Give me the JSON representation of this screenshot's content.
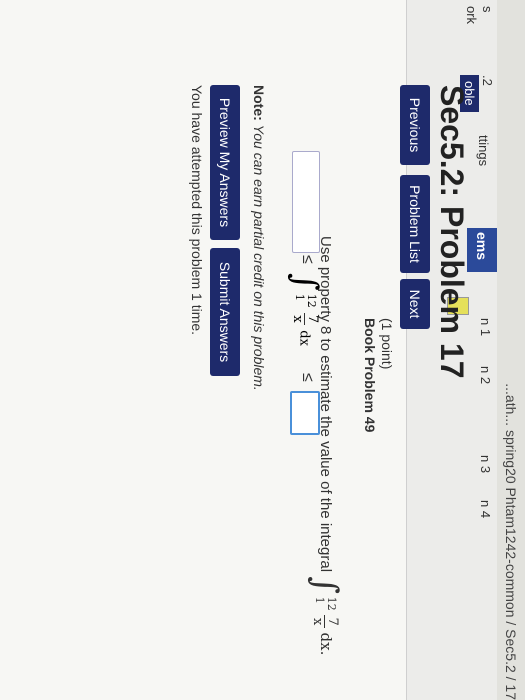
{
  "header": {
    "breadcrumb": "...ath... spring20 Phtam1242-common / Sec5.2 / 17"
  },
  "sidebar": {
    "items": [
      {
        "label": "s"
      },
      {
        "label": "ork"
      },
      {
        "label": ".2"
      },
      {
        "label": "oble"
      },
      {
        "label": "ttings"
      },
      {
        "label": "ems"
      },
      {
        "label": "n 1"
      },
      {
        "label": "n 2"
      },
      {
        "label": "n 3"
      },
      {
        "label": "n 4"
      }
    ]
  },
  "page": {
    "title": "Sec5.2: Problem 17"
  },
  "nav": {
    "previous": "Previous",
    "problem_list": "Problem List",
    "next": "Next"
  },
  "problem": {
    "points": "(1 point)",
    "book_problem": "Book Problem 49",
    "instruction": "Use property 8 to estimate the value of the integral",
    "integral_upper": "12",
    "integral_lower": "1",
    "integrand_num": "7",
    "integrand_den": "x",
    "dx": "dx.",
    "answer_dx": "dx",
    "le_symbol": "≤"
  },
  "note": {
    "label": "Note:",
    "text": "You can earn partial credit on this problem."
  },
  "actions": {
    "preview": "Preview My Answers",
    "submit": "Submit Answers"
  },
  "status": {
    "attempts": "You have attempted this problem 1 time."
  }
}
